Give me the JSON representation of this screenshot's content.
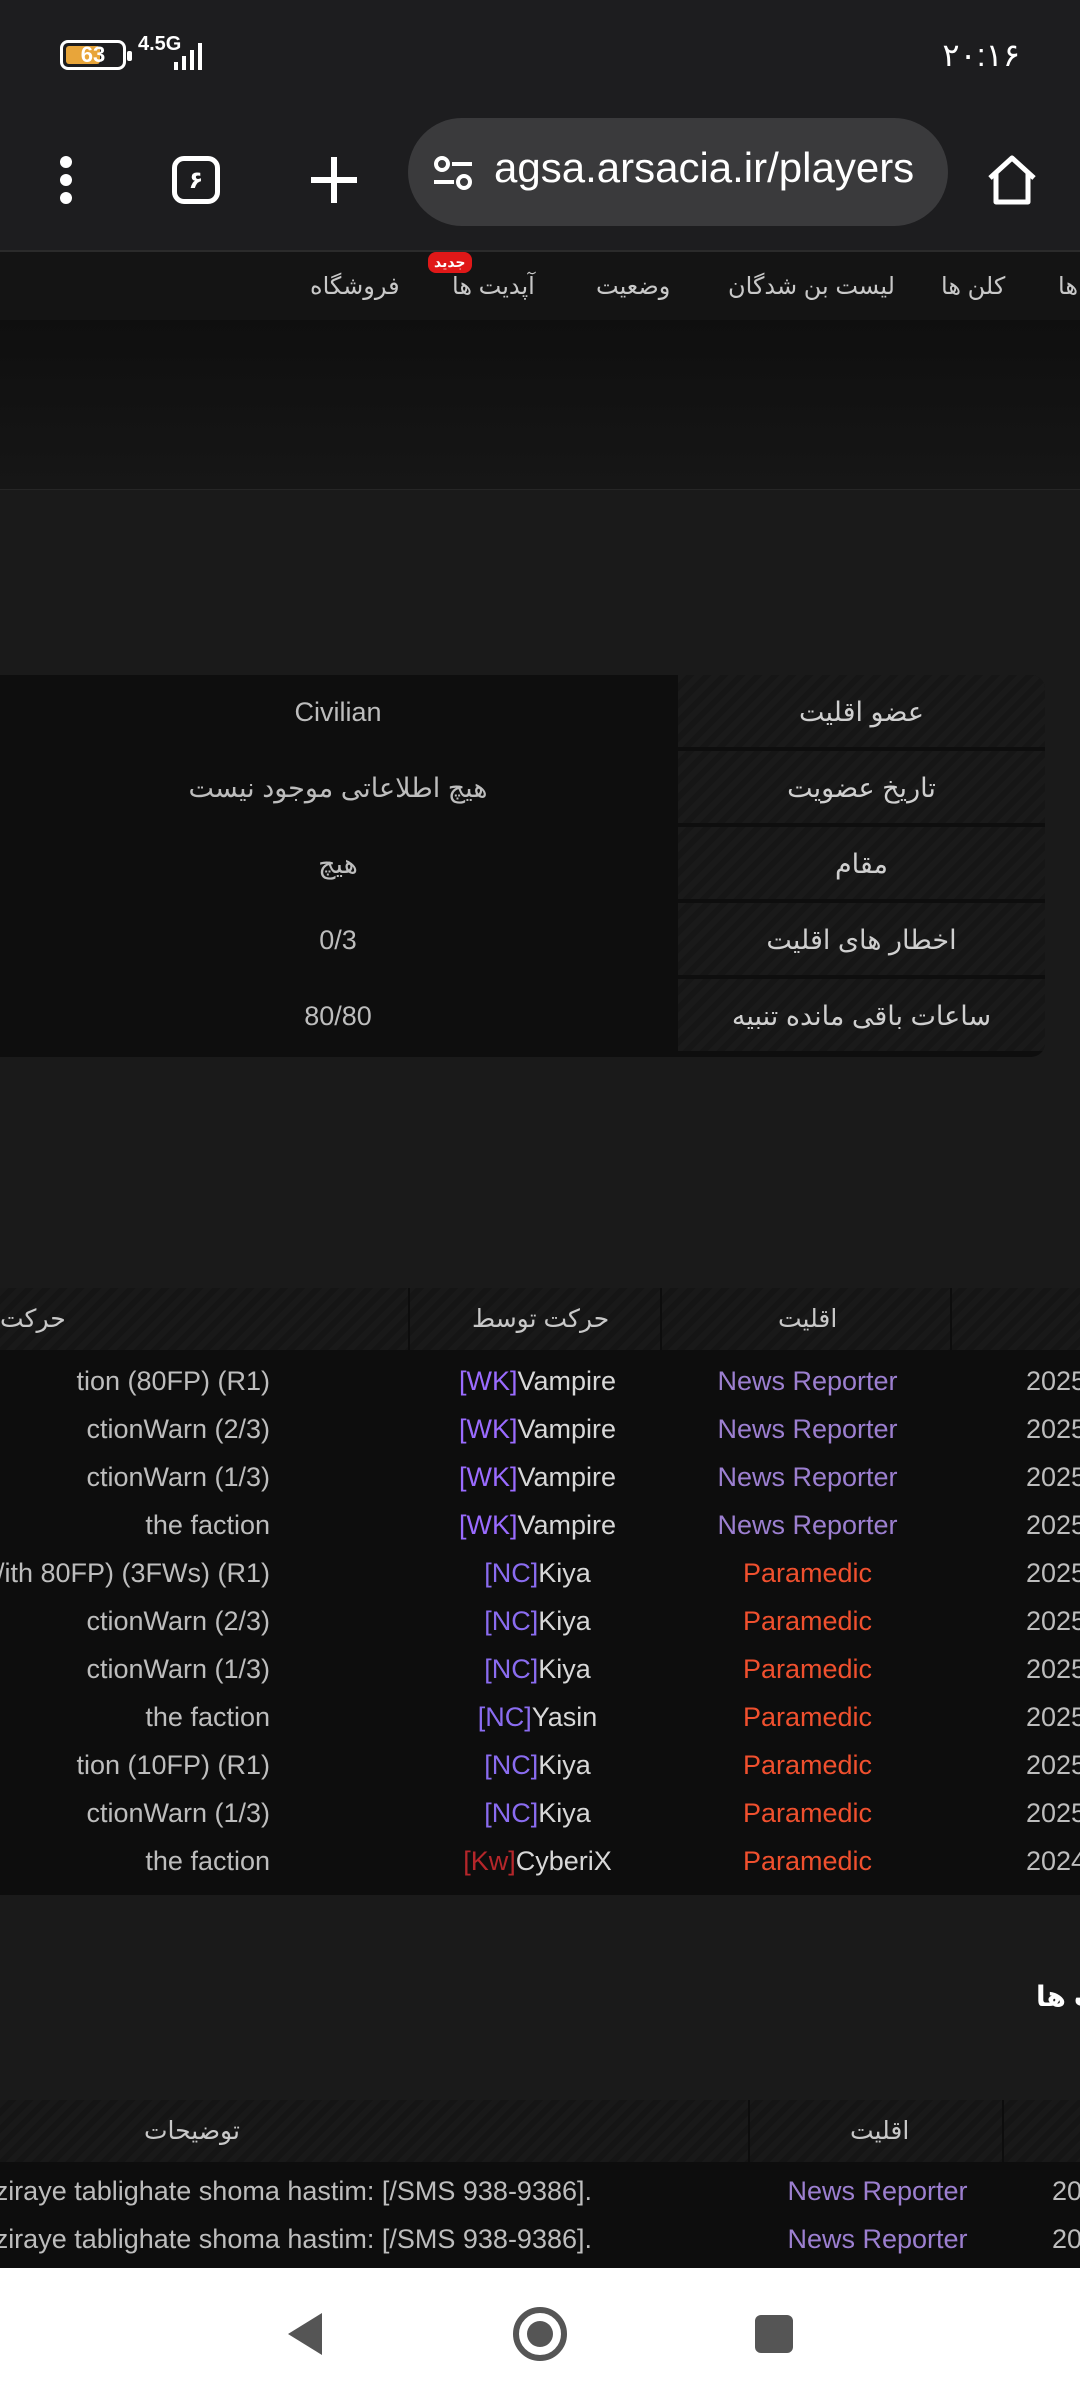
{
  "status_bar": {
    "battery": "63",
    "battery_level": 0.63,
    "network": "4.5G",
    "time": "۲۰:۱۶"
  },
  "browser": {
    "url": "agsa.arsacia.ir/players",
    "tab_count": "۶"
  },
  "site_nav": {
    "items": [
      "فروشگاه",
      "آپدیت ها",
      "وضعیت",
      "لیست بن شدگان",
      "کلن ها",
      "ها"
    ],
    "badge": "جدید"
  },
  "info": [
    {
      "label": "عضو اقلیت",
      "value": "Civilian"
    },
    {
      "label": "تاریخ عضویت",
      "value": "هیچ اطلاعاتی موجود نیست"
    },
    {
      "label": "مقام",
      "value": "هیچ"
    },
    {
      "label": "اخطار های اقلیت",
      "value": "0/3"
    },
    {
      "label": "ساعات باقی مانده تنبیه",
      "value": "80/80"
    }
  ],
  "logs": {
    "headers": {
      "action": "حرکت",
      "by": "حرکت توسط",
      "faction": "اقلیت"
    },
    "rows": [
      {
        "action": "tion (80FP) (R1)",
        "tag": "[WK]",
        "name": "Vampire",
        "faction": "News Reporter",
        "date": "2025"
      },
      {
        "action": "ctionWarn (2/3)",
        "tag": "[WK]",
        "name": "Vampire",
        "faction": "News Reporter",
        "date": "2025"
      },
      {
        "action": "ctionWarn (1/3)",
        "tag": "[WK]",
        "name": "Vampire",
        "faction": "News Reporter",
        "date": "2025"
      },
      {
        "action": "the faction",
        "tag": "[WK]",
        "name": "Vampire",
        "faction": "News Reporter",
        "date": "2025"
      },
      {
        "action": "/ith 80FP) (3FWs) (R1)",
        "tag": "[NC]",
        "name": "Kiya",
        "faction": "Paramedic",
        "date": "2025"
      },
      {
        "action": "ctionWarn (2/3)",
        "tag": "[NC]",
        "name": "Kiya",
        "faction": "Paramedic",
        "date": "2025"
      },
      {
        "action": "ctionWarn (1/3)",
        "tag": "[NC]",
        "name": "Kiya",
        "faction": "Paramedic",
        "date": "2025"
      },
      {
        "action": "the faction",
        "tag": "[NC]",
        "name": "Yasin",
        "faction": "Paramedic",
        "date": "2025"
      },
      {
        "action": "tion (10FP) (R1)",
        "tag": "[NC]",
        "name": "Kiya",
        "faction": "Paramedic",
        "date": "2025"
      },
      {
        "action": "ctionWarn (1/3)",
        "tag": "[NC]",
        "name": "Kiya",
        "faction": "Paramedic",
        "date": "2025"
      },
      {
        "action": "the faction",
        "tag": "[Kw]",
        "name": "CyberiX",
        "faction": "Paramedic",
        "date": "2024"
      }
    ]
  },
  "second_section": {
    "title": "ت ها",
    "headers": {
      "desc": "توضیحات",
      "faction": "اقلیت"
    },
    "rows": [
      {
        "text": "ziraye tablighate shoma hastim: [/SMS 938-9386].",
        "faction": "News Reporter",
        "date": "20"
      },
      {
        "text": "ziraye tablighate shoma hastim: [/SMS 938-9386].",
        "faction": "News Reporter",
        "date": "20"
      }
    ]
  },
  "colors": {
    "news_reporter": "#9c7fd0",
    "paramedic": "#f0502e",
    "tag_wk": "#9a6bff",
    "tag_nc": "#8a6cf0",
    "tag_kw": "#b5262a",
    "battery": "#e8a53a"
  }
}
